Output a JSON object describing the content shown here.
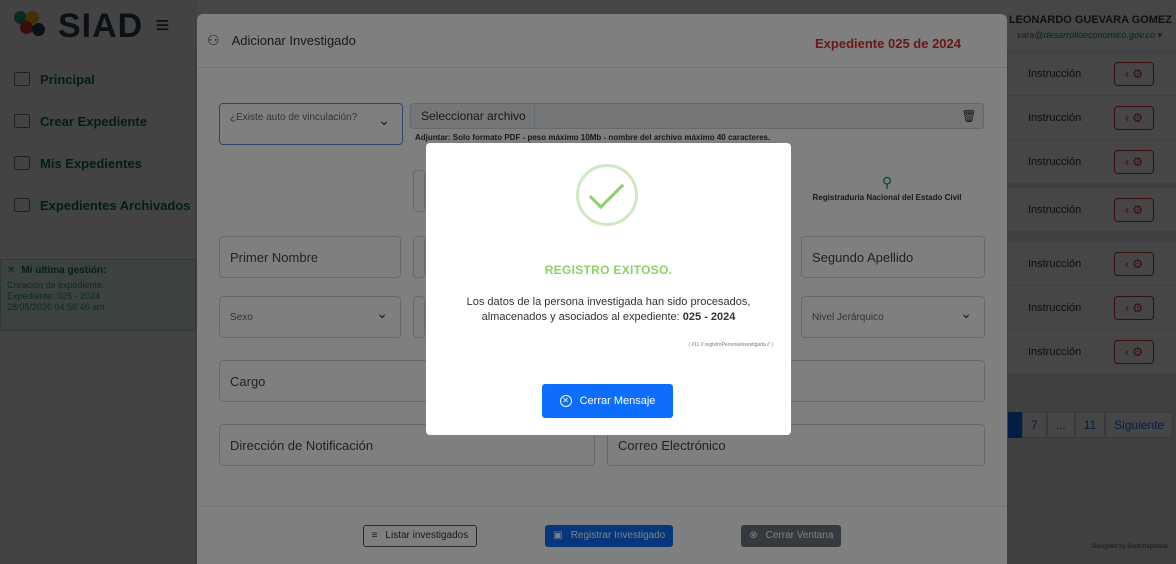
{
  "app": {
    "logo": "SIAD",
    "menu_icon": "hamburger-icon"
  },
  "sidebar": {
    "items": [
      {
        "label": "Principal",
        "icon": "home-icon"
      },
      {
        "label": "Crear Expediente",
        "icon": "folder-icon"
      },
      {
        "label": "Mis Expedientes",
        "icon": "list-icon"
      },
      {
        "label": "Expedientes Archivados",
        "icon": "archive-icon"
      }
    ],
    "gestion": {
      "title": "Mi última gestión:",
      "line1": "Creación de expediente.",
      "line2": "Expediente: 025 - 2024",
      "line3": "28/05/2026 04:56:46 am"
    }
  },
  "user": {
    "name": "IARD LEONARDO GUEVARA GOMEZ",
    "email": "vara@desarrolloeconomico.gov.co ▾"
  },
  "table": {
    "rows": [
      {
        "status": "Instrucción"
      },
      {
        "status": "Instrucción"
      },
      {
        "status": "Instrucción"
      },
      {
        "status": "Instrucción"
      },
      {
        "status": "Instrucción"
      },
      {
        "status": "Instrucción"
      },
      {
        "status": "Instrucción"
      }
    ],
    "pager": {
      "page7": "7",
      "ellipsis": "...",
      "page11": "11",
      "next": "Siguiente"
    }
  },
  "credit": "Designed by BootstrapMade",
  "modal": {
    "title": "Adicionar Investigado",
    "expediente": "Expediente 025 de 2024",
    "vinculacion_placeholder": "¿Existe auto de vinculación?",
    "file_button": "Seleccionar archivo",
    "file_help": "Adjuntar: Solo formato PDF - peso máximo 10Mb - nombre del archivo máximo 40 caracteres.",
    "registraduria": "Registraduría Nacional del Estado Civil",
    "primer_nombre": "Primer Nombre",
    "segundo_apellido": "Segundo Apellido",
    "sexo": "Sexo",
    "nivel": "Nivel Jerárquico",
    "cargo": "Cargo",
    "direccion": "Dirección de Notificación",
    "correo": "Correo Electrónico",
    "btn_listar": "Listar investigados",
    "btn_registrar": "Registrar Investigado",
    "btn_cerrar": "Cerrar Ventana"
  },
  "alert": {
    "title": "REGISTRO EXITOSO.",
    "message": "Los datos de la persona investigada han sido procesados, almacenados y asociados al expediente:",
    "expediente": "025 - 2024",
    "code": "( #11 // registroPersonaInvestigada // )",
    "close_label": "Cerrar Mensaje"
  }
}
